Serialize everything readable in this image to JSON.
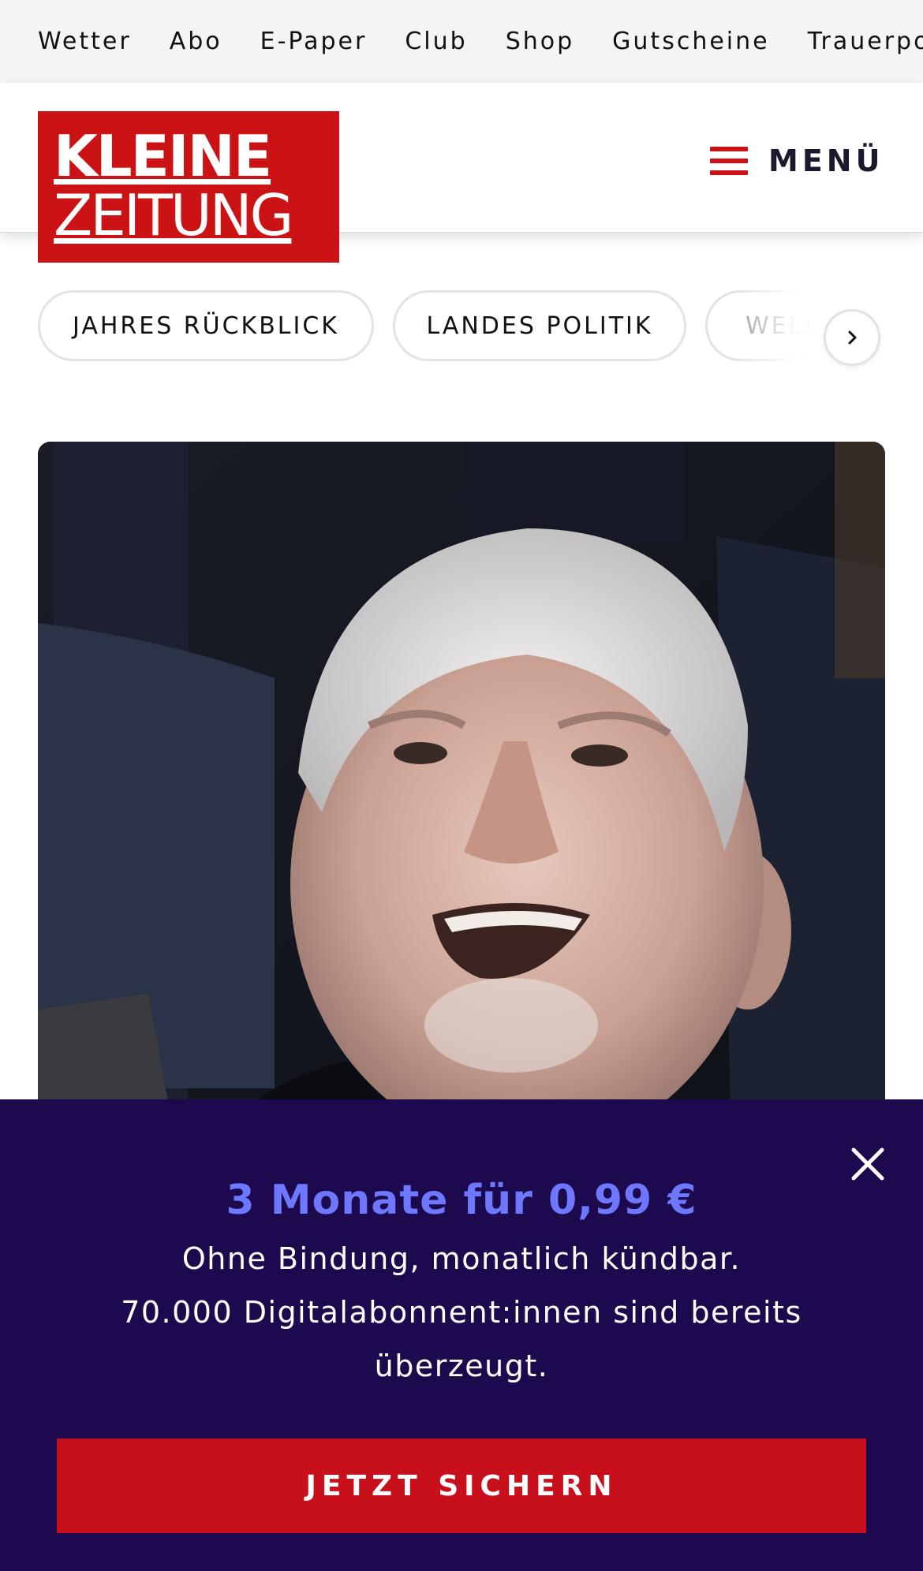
{
  "topnav": {
    "items": [
      "Wetter",
      "Abo",
      "E-Paper",
      "Club",
      "Shop",
      "Gutscheine",
      "Trauerportal"
    ]
  },
  "header": {
    "logo_line1": "KLEINE",
    "logo_line2": "ZEITUNG",
    "menu_label": "MENÜ"
  },
  "categories": {
    "pills": [
      "JAHRES RÜCKBLICK",
      "LANDES POLITIK",
      "WELT"
    ]
  },
  "hero": {
    "image": "portrait-of-elderly-man-smiling"
  },
  "promo": {
    "title": "3 Monate für 0,99 €",
    "line1": "Ohne Bindung, monatlich kündbar.",
    "line2": "70.000 Digitalabonnent:innen sind bereits",
    "line3": "überzeugt.",
    "cta_label": "JETZT SICHERN"
  },
  "colors": {
    "brand_red": "#cb1214",
    "promo_bg": "#1d0a4e",
    "promo_accent": "#6d78ff"
  }
}
